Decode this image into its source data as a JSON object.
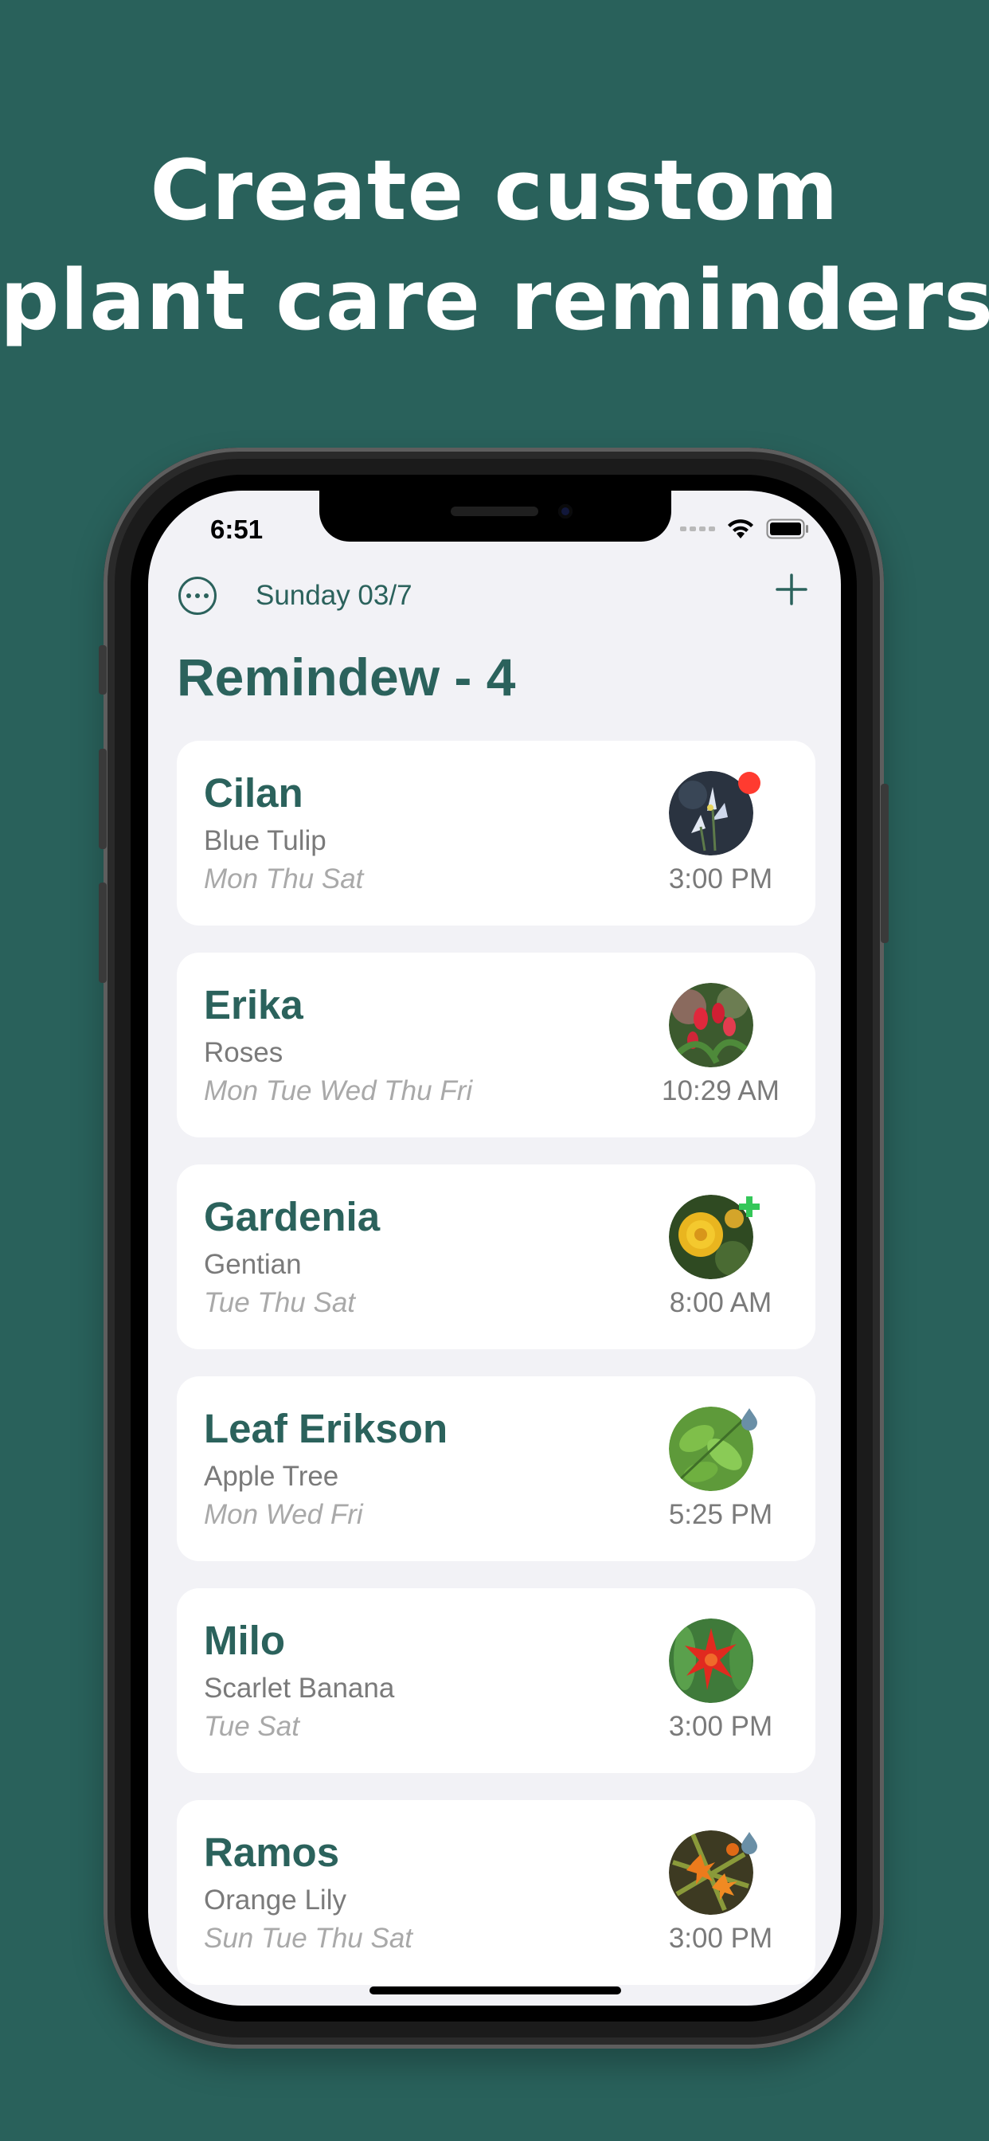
{
  "headline": {
    "line1": "Create custom",
    "line2": "plant care reminders"
  },
  "status_bar": {
    "time": "6:51"
  },
  "topbar": {
    "date": "Sunday 03/7"
  },
  "title": "Remindew - 4",
  "reminders": [
    {
      "name": "Cilan",
      "species": "Blue Tulip",
      "days": "Mon Thu Sat",
      "time": "3:00 PM",
      "badge": "red-dot-icon"
    },
    {
      "name": "Erika",
      "species": "Roses",
      "days": "Mon Tue Wed Thu Fri",
      "time": "10:29 AM",
      "badge": ""
    },
    {
      "name": "Gardenia",
      "species": "Gentian",
      "days": "Tue Thu Sat",
      "time": "8:00 AM",
      "badge": "green-plus-icon"
    },
    {
      "name": "Leaf Erikson",
      "species": "Apple Tree",
      "days": "Mon Wed Fri",
      "time": "5:25 PM",
      "badge": "water-drop-icon"
    },
    {
      "name": "Milo",
      "species": "Scarlet Banana",
      "days": "Tue Sat",
      "time": "3:00 PM",
      "badge": ""
    },
    {
      "name": "Ramos",
      "species": "Orange Lily",
      "days": "Sun Tue Thu Sat",
      "time": "3:00 PM",
      "badge": "water-drop-icon"
    }
  ],
  "colors": {
    "background": "#29615b",
    "accent": "#2b625c",
    "card": "#ffffff",
    "screen": "#f2f2f6"
  }
}
